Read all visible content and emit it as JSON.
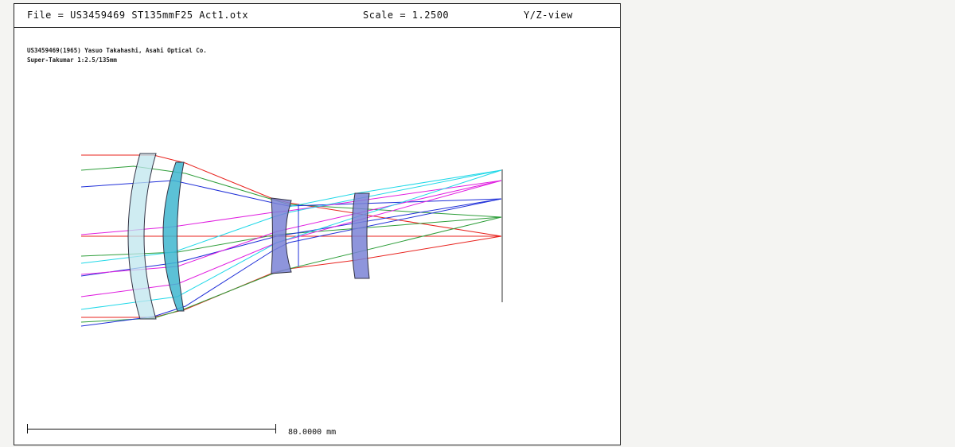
{
  "header": {
    "file": "File = US3459469 ST135mmF25 Act1.otx",
    "scale": "Scale = 1.2500",
    "view": "Y/Z-view"
  },
  "description": {
    "line1": "US3459469(1965) Yasuo Takahashi, Asahi Optical Co.",
    "line2": "Super-Takumar 1:2.5/135mm"
  },
  "scale_bar": {
    "label": "80.0000 mm"
  },
  "colors": {
    "frame": "#222222",
    "lens_fill_1": "#bfe6ee",
    "lens_fill_2": "#3fb6cf",
    "lens_fill_3": "#7a82d6",
    "ray_red": "#e8231e",
    "ray_green": "#2e9e3a",
    "ray_blue": "#1f2fd8",
    "ray_magenta": "#e020e0",
    "ray_cyan": "#20d8e8"
  }
}
